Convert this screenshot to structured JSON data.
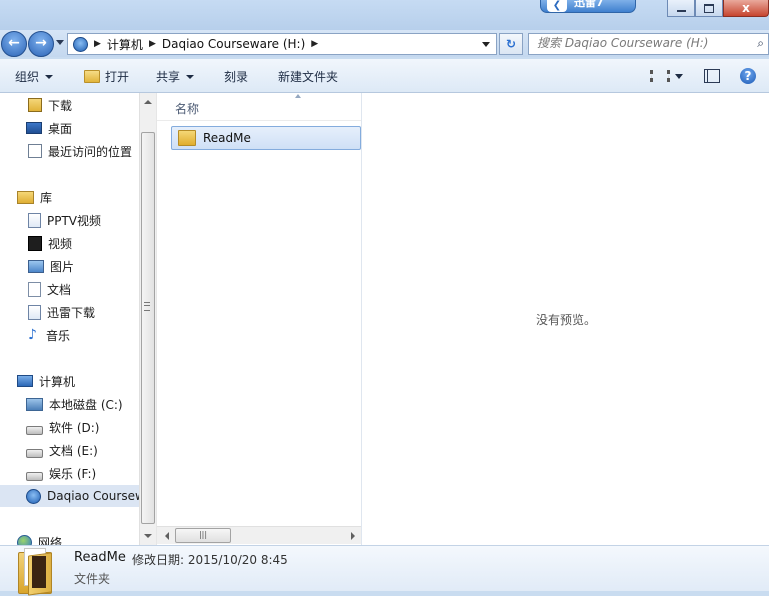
{
  "window": {
    "thunder_tab_label": "迅雷7",
    "controls": {
      "minimize": "",
      "maximize": "",
      "close": "x"
    }
  },
  "nav": {
    "back": "←",
    "forward": "→",
    "breadcrumbs": [
      "计算机",
      "Daqiao Courseware (H:)"
    ],
    "refresh": "↻",
    "search_placeholder": "搜索 Daqiao Courseware (H:)",
    "search_icon": "⌕"
  },
  "toolbar": {
    "organize": "组织",
    "open": "打开",
    "share": "共享",
    "burn": "刻录",
    "new_folder": "新建文件夹",
    "help": "?"
  },
  "sidebar": {
    "favorites": [
      {
        "label": "下载",
        "icon": "downloads-icon"
      },
      {
        "label": "桌面",
        "icon": "desktop-icon"
      },
      {
        "label": "最近访问的位置",
        "icon": "recent-places-icon"
      }
    ],
    "libraries_header": "库",
    "libraries": [
      {
        "label": "PPTV视频",
        "icon": "library-document-icon"
      },
      {
        "label": "视频",
        "icon": "video-icon"
      },
      {
        "label": "图片",
        "icon": "pictures-icon"
      },
      {
        "label": "文档",
        "icon": "documents-icon"
      },
      {
        "label": "迅雷下载",
        "icon": "library-document-icon"
      },
      {
        "label": "音乐",
        "icon": "music-icon"
      }
    ],
    "computer_header": "计算机",
    "drives": [
      {
        "label": "本地磁盘 (C:)",
        "icon": "system-drive-icon"
      },
      {
        "label": "软件 (D:)",
        "icon": "drive-icon"
      },
      {
        "label": "文档 (E:)",
        "icon": "drive-icon"
      },
      {
        "label": "娱乐 (F:)",
        "icon": "drive-icon"
      },
      {
        "label": "Daqiao Courseware (H:)",
        "icon": "app-drive-icon",
        "selected": true
      }
    ],
    "network_header": "网络"
  },
  "file_list": {
    "column_name": "名称",
    "items": [
      {
        "name": "ReadMe",
        "type": "folder",
        "selected": true
      }
    ],
    "hscroll_grip": "|||"
  },
  "preview": {
    "message": "没有预览。"
  },
  "details": {
    "name": "ReadMe",
    "modified_label": "修改日期:",
    "modified_value": "2015/10/20 8:45",
    "type": "文件夹"
  }
}
